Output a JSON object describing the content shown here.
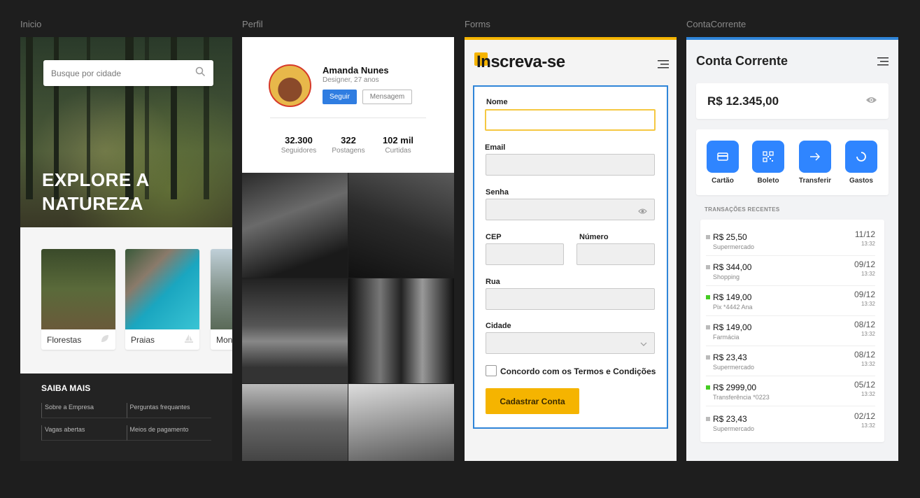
{
  "frames": {
    "inicio_label": "Inicio",
    "perfil_label": "Perfil",
    "forms_label": "Forms",
    "conta_label": "ContaCorrente"
  },
  "inicio": {
    "search_placeholder": "Busque por cidade",
    "hero_title_line1": "EXPLORE A",
    "hero_title_line2": "NATUREZA",
    "cards": [
      {
        "label": "Florestas",
        "icon": "leaf-icon"
      },
      {
        "label": "Praias",
        "icon": "sailboat-icon"
      },
      {
        "label": "Mon",
        "icon": "mountain-icon"
      }
    ],
    "footer_title": "SAIBA MAIS",
    "footer_links": [
      "Sobre a Empresa",
      "Perguntas frequantes",
      "Vagas abertas",
      "Meios de pagamento"
    ]
  },
  "perfil": {
    "name": "Amanda Nunes",
    "subtitle": "Designer, 27 anos",
    "follow_label": "Seguir",
    "message_label": "Mensagem",
    "stats": [
      {
        "value": "32.300",
        "label": "Seguidores"
      },
      {
        "value": "322",
        "label": "Postagens"
      },
      {
        "value": "102 mil",
        "label": "Curtidas"
      }
    ]
  },
  "forms": {
    "title": "Inscreva-se",
    "fields": {
      "nome": "Nome",
      "email": "Email",
      "senha": "Senha",
      "cep": "CEP",
      "numero": "Número",
      "rua": "Rua",
      "cidade": "Cidade"
    },
    "terms_label": "Concordo com os Termos e Condições",
    "submit_label": "Cadastrar Conta",
    "accent": "#f5b400",
    "focus_border": "#2f85d8"
  },
  "conta": {
    "title": "Conta Corrente",
    "balance": "R$ 12.345,00",
    "actions": [
      {
        "label": "Cartão",
        "icon": "card-icon"
      },
      {
        "label": "Boleto",
        "icon": "barcode-icon"
      },
      {
        "label": "Transferir",
        "icon": "arrow-right-icon"
      },
      {
        "label": "Gastos",
        "icon": "pie-icon"
      }
    ],
    "transactions_heading": "TRANSAÇÕES RECENTES",
    "transactions": [
      {
        "amount": "R$ 25,50",
        "desc": "Supermercado",
        "date": "11/12",
        "time": "13:32",
        "type": "out"
      },
      {
        "amount": "R$ 344,00",
        "desc": "Shopping",
        "date": "09/12",
        "time": "13:32",
        "type": "out"
      },
      {
        "amount": "R$ 149,00",
        "desc": "Pix *4442 Ana",
        "date": "09/12",
        "time": "13:32",
        "type": "in"
      },
      {
        "amount": "R$ 149,00",
        "desc": "Farmácia",
        "date": "08/12",
        "time": "13:32",
        "type": "out"
      },
      {
        "amount": "R$ 23,43",
        "desc": "Supermercado",
        "date": "08/12",
        "time": "13:32",
        "type": "out"
      },
      {
        "amount": "R$ 2999,00",
        "desc": "Transferência *0223",
        "date": "05/12",
        "time": "13:32",
        "type": "in"
      },
      {
        "amount": "R$ 23,43",
        "desc": "Supermercado",
        "date": "02/12",
        "time": "13:32",
        "type": "out"
      }
    ]
  }
}
